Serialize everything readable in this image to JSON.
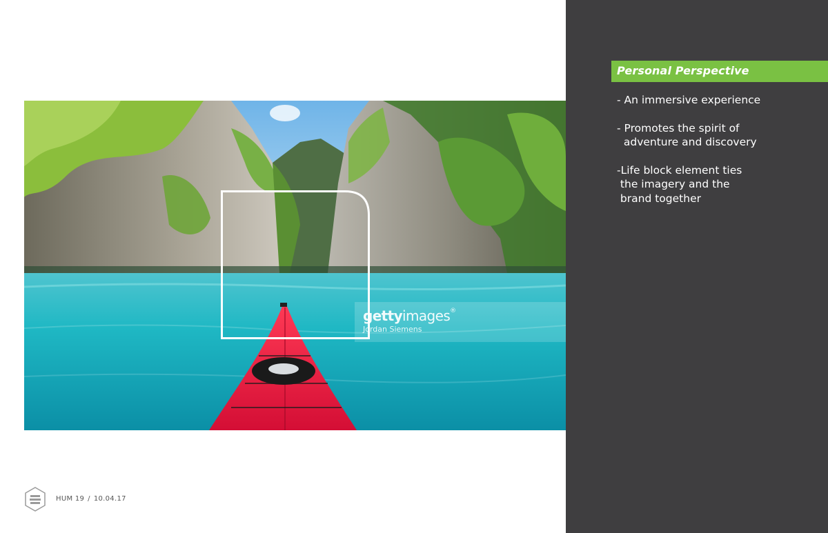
{
  "panel": {
    "heading": "Personal Perspective",
    "bullets": [
      "- An immersive experience",
      "- Promotes the spirit of\n  adventure and discovery",
      "-Life block element ties\n the imagery and the\n brand together"
    ]
  },
  "photo": {
    "watermark_brand_bold": "getty",
    "watermark_brand_light": "images",
    "watermark_mark": "®",
    "watermark_author": "Jordan Siemens"
  },
  "footer": {
    "course": "HUM 19",
    "separator": "/",
    "date": "10.04.17"
  },
  "colors": {
    "accent_green": "#7ac143",
    "panel_dark": "#3f3e40",
    "kayak_red": "#e8163e",
    "water_turquoise": "#1fb8c4"
  },
  "icons": {
    "footer_logo": "hexagon-stack-logo-icon",
    "life_block": "rounded-square-frame-icon"
  }
}
